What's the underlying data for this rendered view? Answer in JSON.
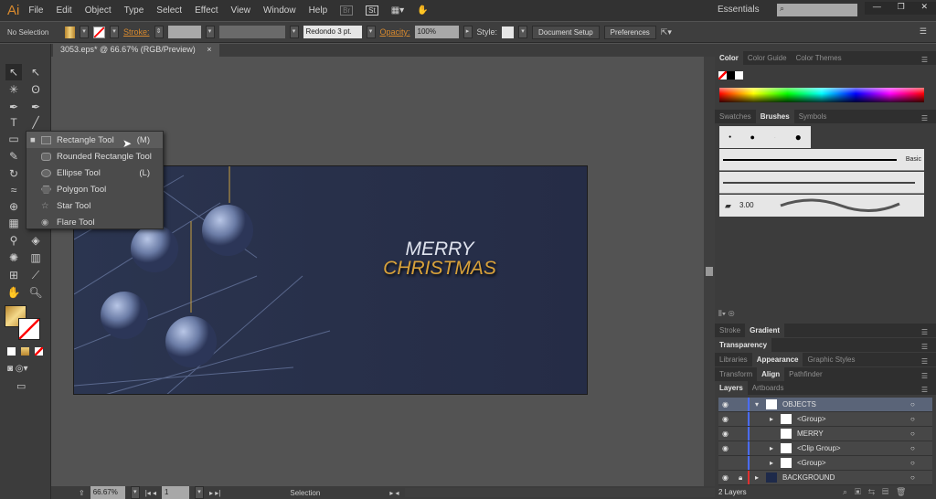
{
  "app": {
    "logo": "Ai",
    "menu": [
      "File",
      "Edit",
      "Object",
      "Type",
      "Select",
      "Effect",
      "View",
      "Window",
      "Help"
    ],
    "workspace": "Essentials",
    "search_placeholder": ""
  },
  "control": {
    "selection": "No Selection",
    "stroke_label": "Stroke:",
    "brush": "Redondo 3 pt.",
    "opacity_label": "Opacity:",
    "opacity": "100%",
    "style_label": "Style:",
    "document_setup": "Document Setup",
    "preferences": "Preferences"
  },
  "document": {
    "tab": "3053.eps* @ 66.67% (RGB/Preview)",
    "close": "×"
  },
  "flyout": [
    {
      "label": "Rectangle Tool",
      "shortcut": "(M)"
    },
    {
      "label": "Rounded Rectangle Tool",
      "shortcut": ""
    },
    {
      "label": "Ellipse Tool",
      "shortcut": "(L)"
    },
    {
      "label": "Polygon Tool",
      "shortcut": ""
    },
    {
      "label": "Star Tool",
      "shortcut": ""
    },
    {
      "label": "Flare Tool",
      "shortcut": ""
    }
  ],
  "artwork": {
    "line1": "MERRY",
    "line2": "CHRISTMAS",
    "bg": "#28304a",
    "gold": "#d9a23a"
  },
  "status": {
    "zoom": "66.67%",
    "artboard": "1",
    "tool": "Selection"
  },
  "panels": {
    "color_tabs": [
      "Color",
      "Color Guide",
      "Color Themes"
    ],
    "brush_tabs": [
      "Swatches",
      "Brushes",
      "Symbols"
    ],
    "brush_basic": "Basic",
    "brush_size": "3.00",
    "stroke_tabs": [
      "Stroke",
      "Gradient"
    ],
    "transparency_tabs": [
      "Transparency"
    ],
    "appearance_tabs": [
      "Libraries",
      "Appearance",
      "Graphic Styles"
    ],
    "align_tabs": [
      "Transform",
      "Align",
      "Pathfinder"
    ],
    "layers_tabs": [
      "Layers",
      "Artboards"
    ],
    "layers": [
      {
        "name": "OBJECTS",
        "level": 0,
        "expanded": true,
        "color": "#4a6cff"
      },
      {
        "name": "<Group>",
        "level": 1,
        "color": "#4a6cff"
      },
      {
        "name": "MERRY",
        "level": 1,
        "color": "#4a6cff"
      },
      {
        "name": "<Clip Group>",
        "level": 1,
        "color": "#4a6cff"
      },
      {
        "name": "<Group>",
        "level": 1,
        "color": "#4a6cff"
      },
      {
        "name": "BACKGROUND",
        "level": 0,
        "locked": true,
        "color": "#e03030"
      }
    ],
    "layers_count": "2 Layers"
  }
}
